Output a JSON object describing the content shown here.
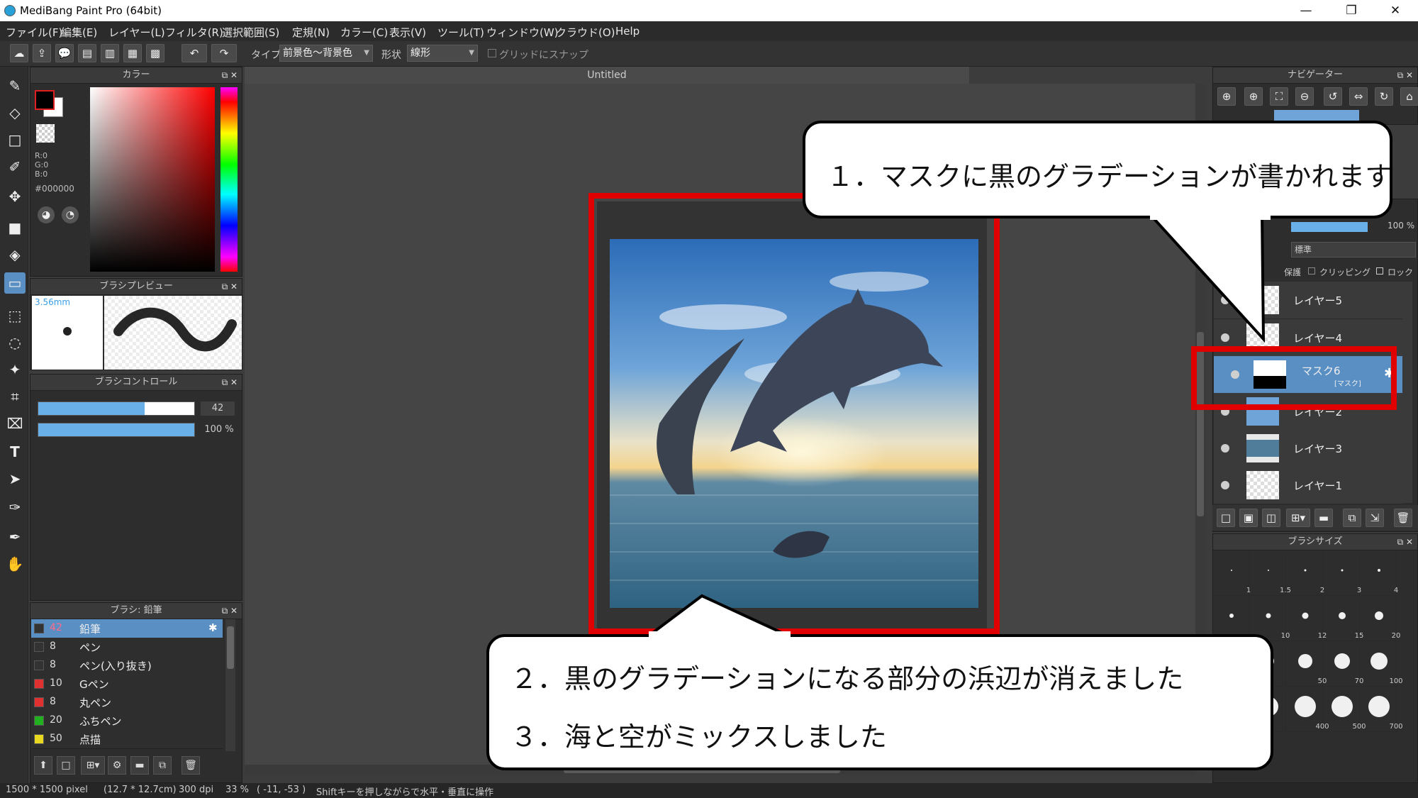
{
  "window": {
    "title": "MediBang Paint Pro (64bit)",
    "minimize": "—",
    "restore": "❐",
    "close": "✕"
  },
  "menu": [
    "ファイル(F)",
    "編集(E)",
    "レイヤー(L)",
    "フィルタ(R)",
    "選択範囲(S)",
    "定規(N)",
    "カラー(C)",
    "表示(V)",
    "ツール(T)",
    "ウィンドウ(W)",
    "クラウド(O)",
    "Help"
  ],
  "toolbar": {
    "type_label": "タイプ",
    "type_value": "前景色～背景色",
    "shape_label": "形状",
    "shape_value": "線形",
    "snap_label": "グリッドにスナップ"
  },
  "color_panel": {
    "title": "カラー",
    "r": "R:0",
    "g": "G:0",
    "b": "B:0",
    "hex": "#000000",
    "foreground": "#000000",
    "background": "#ffffff"
  },
  "brush_preview": {
    "title": "ブラシプレビュー",
    "size": "3.56mm"
  },
  "brush_control": {
    "title": "ブラシコントロール",
    "size_value": "42",
    "opacity_value": "100 %",
    "size_fraction": 0.68,
    "opacity_fraction": 1.0
  },
  "brush_list": {
    "title": "ブラシ: 鉛筆",
    "items": [
      {
        "size": "42",
        "name": "鉛筆",
        "color": "#333333",
        "selected": true
      },
      {
        "size": "8",
        "name": "ペン",
        "color": "#333333"
      },
      {
        "size": "8",
        "name": "ペン(入り抜き)",
        "color": "#333333"
      },
      {
        "size": "10",
        "name": "Gペン",
        "color": "#e03030"
      },
      {
        "size": "8",
        "name": "丸ペン",
        "color": "#e03030"
      },
      {
        "size": "20",
        "name": "ふちペン",
        "color": "#20b020"
      },
      {
        "size": "50",
        "name": "点描",
        "color": "#e8d820"
      }
    ]
  },
  "canvas": {
    "tab_title": "Untitled"
  },
  "navigator": {
    "title": "ナビゲーター"
  },
  "layer_panel": {
    "opacity": "100 %",
    "clipping": "クリッピング",
    "lock": "ロック",
    "protect": "保護",
    "blend": "標準",
    "layers": [
      {
        "name": "レイヤー5"
      },
      {
        "name": "レイヤー4"
      },
      {
        "name": "マスク6",
        "sub": "[マスク]",
        "selected": true
      },
      {
        "name": "レイヤー2"
      },
      {
        "name": "レイヤー3"
      },
      {
        "name": "レイヤー1"
      }
    ]
  },
  "brush_size_panel": {
    "title": "ブラシサイズ",
    "rows": [
      [
        "1",
        "1.5",
        "2",
        "3",
        "4"
      ],
      [
        "",
        "10",
        "12",
        "15",
        "20"
      ],
      [
        "",
        "",
        "50",
        "70",
        "100"
      ],
      [
        "",
        "",
        "400",
        "500",
        "700"
      ]
    ]
  },
  "callouts": {
    "c1": "１．マスクに黒のグラデーションが書かれます",
    "c2": "２．黒のグラデーションになる部分の浜辺が消えました",
    "c3": "３．海と空がミックスしました"
  },
  "status": {
    "size": "1500 * 1500 pixel",
    "cm": "(12.7 * 12.7cm)",
    "dpi": "300 dpi",
    "zoom": "33 %",
    "coords": "( -11, -53 )",
    "hint": "Shiftキーを押しながらで水平・垂直に操作"
  }
}
